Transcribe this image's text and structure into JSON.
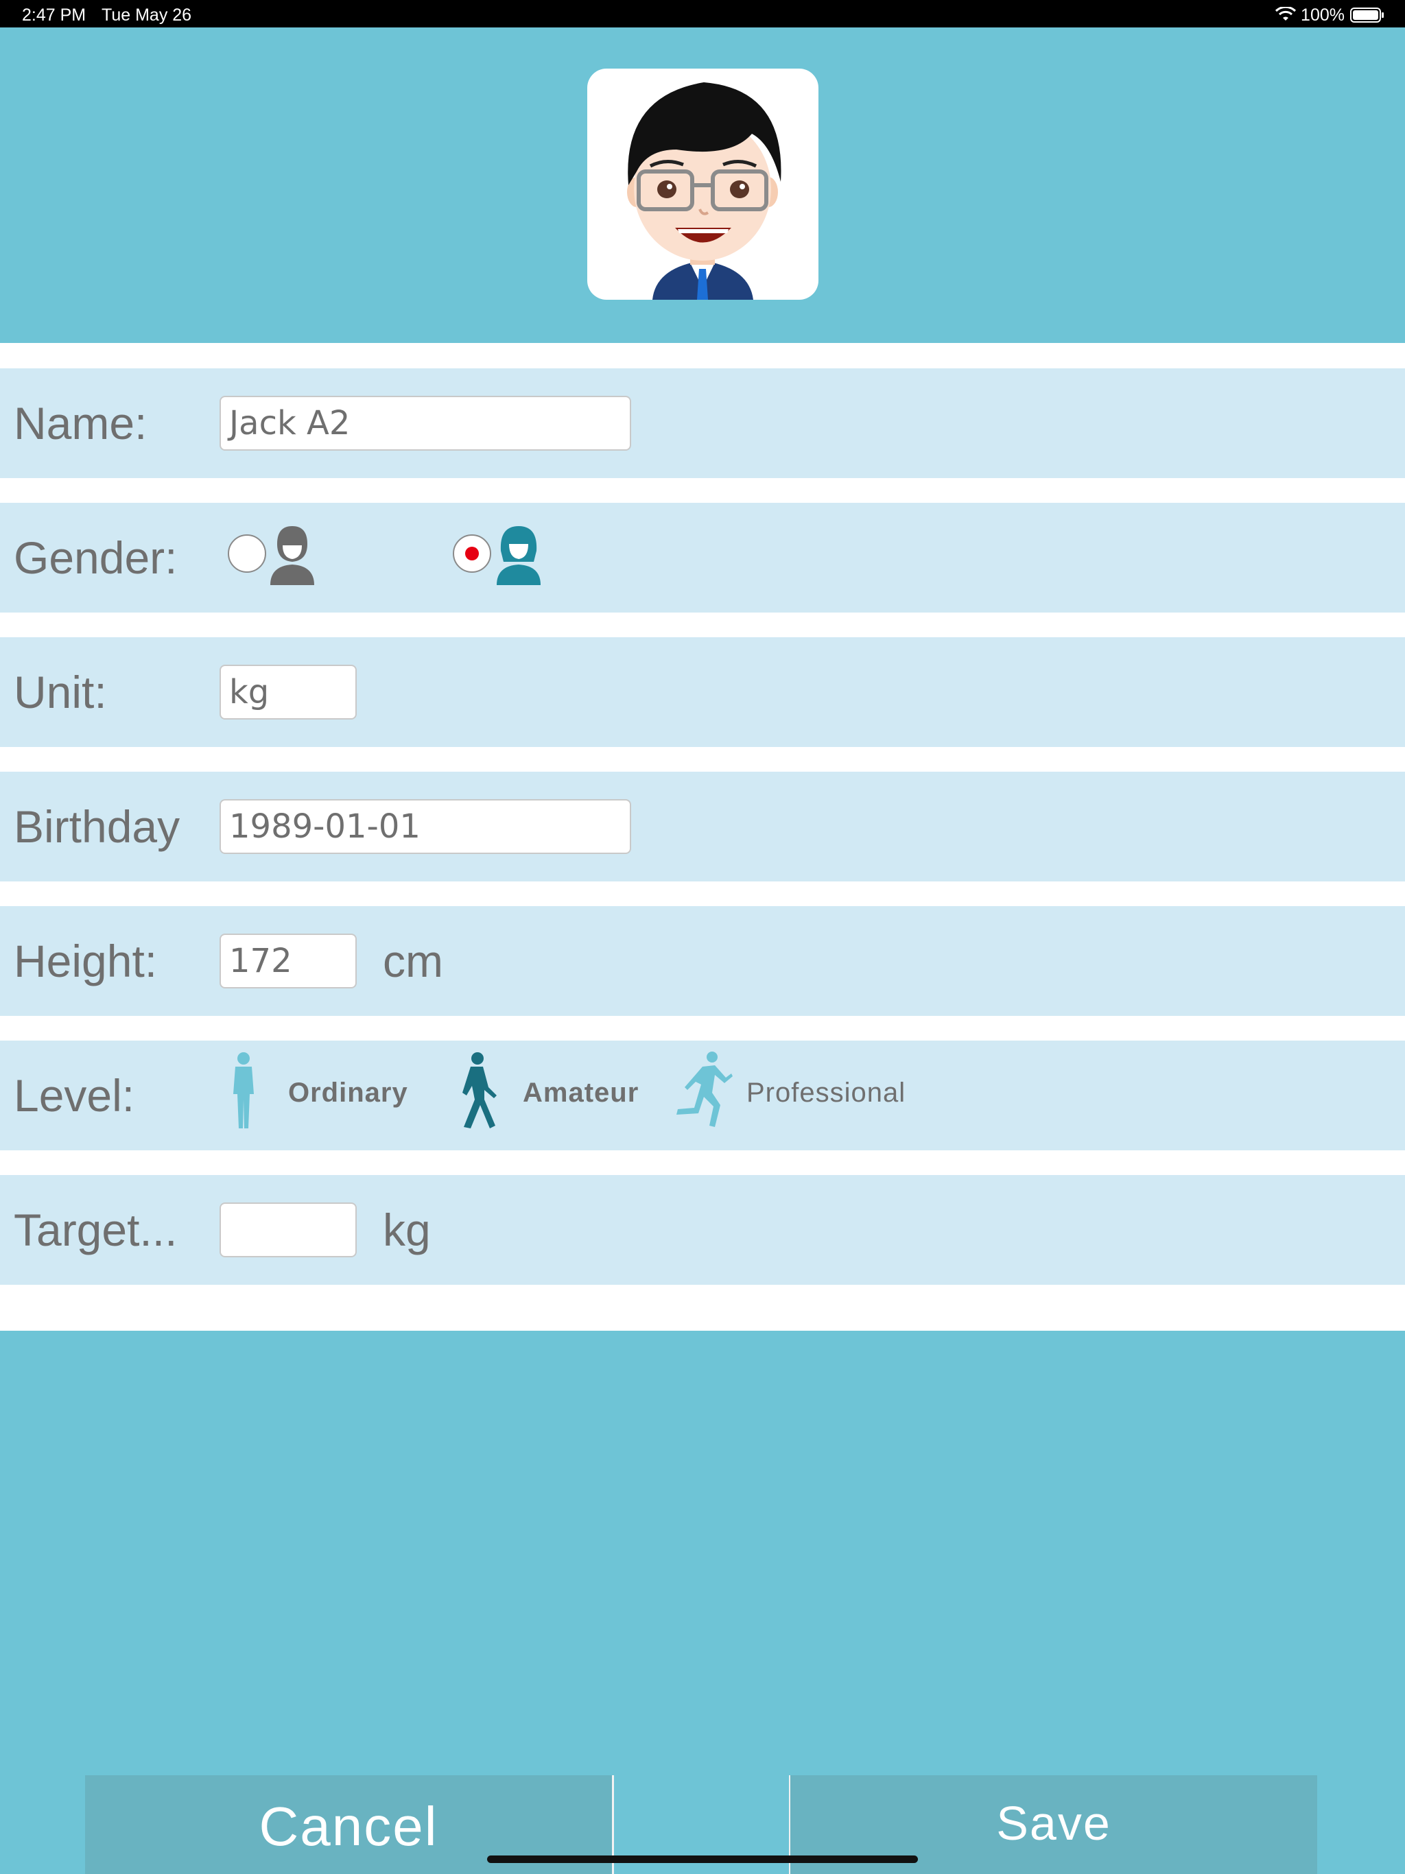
{
  "status_bar": {
    "time": "2:47 PM",
    "date": "Tue May 26",
    "battery": "100%"
  },
  "profile": {
    "avatar": "cartoon-man-with-glasses"
  },
  "form": {
    "name": {
      "label": "Name:",
      "value": "Jack A2"
    },
    "gender": {
      "label": "Gender:",
      "options": [
        "male",
        "female"
      ],
      "selected": "female"
    },
    "unit": {
      "label": "Unit:",
      "value": "kg"
    },
    "birthday": {
      "label": "Birthday",
      "value": "1989-01-01"
    },
    "height": {
      "label": "Height:",
      "value": "172",
      "unit": "cm"
    },
    "level": {
      "label": "Level:",
      "options": [
        "Ordinary",
        "Amateur",
        "Professional"
      ],
      "selected": "Amateur"
    },
    "target": {
      "label": "Target...",
      "value": "",
      "unit": "kg"
    }
  },
  "actions": {
    "cancel": "Cancel",
    "save": "Save"
  },
  "colors": {
    "background": "#6ec4d6",
    "row": "#d1e9f4",
    "selected_radio": "#e60012",
    "button": "#69b3c1"
  }
}
